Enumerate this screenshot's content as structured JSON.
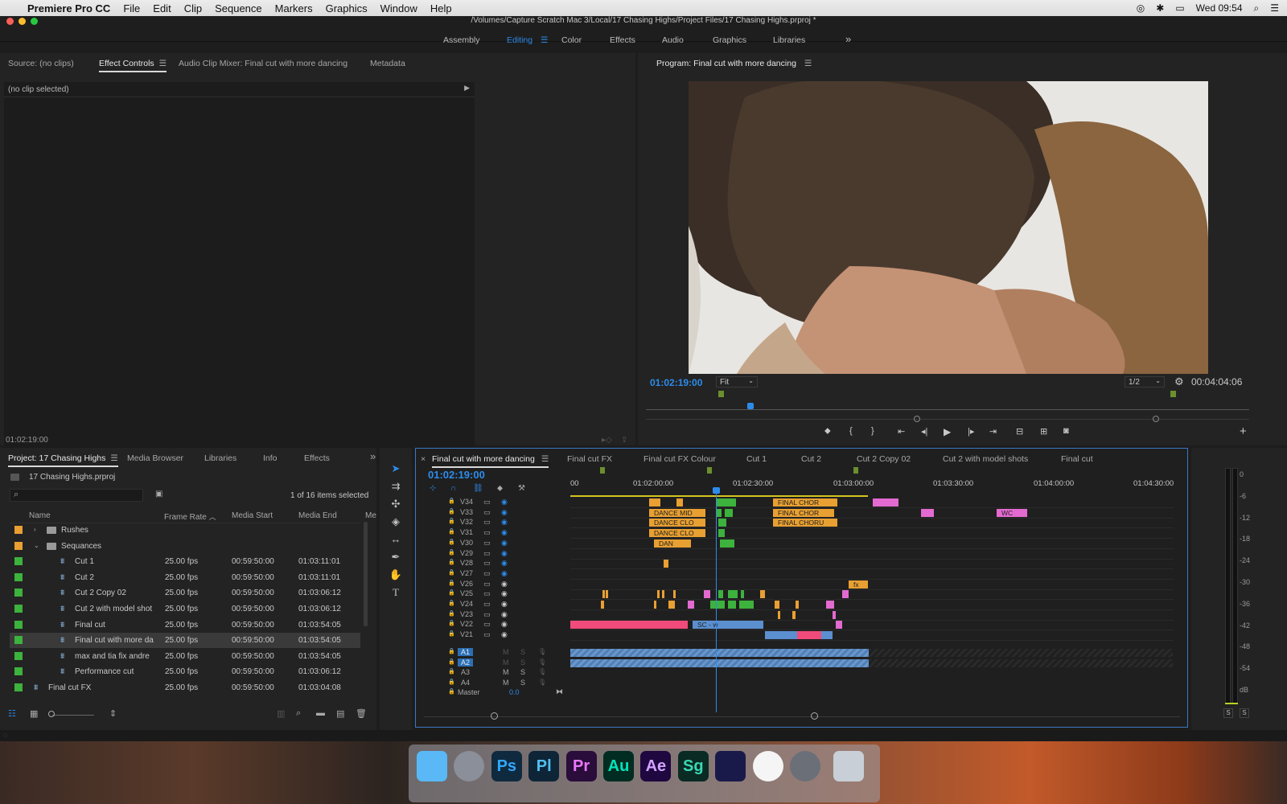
{
  "menubar": {
    "app_name": "Premiere Pro CC",
    "items": [
      "File",
      "Edit",
      "Clip",
      "Sequence",
      "Markers",
      "Graphics",
      "Window",
      "Help"
    ],
    "clock": "Wed 09:54"
  },
  "window": {
    "title": "/Volumes/Capture Scratch Mac 3/Local/17 Chasing Highs/Project Files/17 Chasing Highs.prproj *"
  },
  "workspaces": {
    "tabs": [
      "Assembly",
      "Editing",
      "Color",
      "Effects",
      "Audio",
      "Graphics",
      "Libraries"
    ],
    "active": "Editing",
    "overflow": "»"
  },
  "source_panel": {
    "tabs": [
      "Source: (no clips)",
      "Effect Controls",
      "Audio Clip Mixer: Final cut with more dancing",
      "Metadata"
    ],
    "active_tab": "Effect Controls",
    "no_clip_text": "(no clip selected)",
    "timecode": "01:02:19:00"
  },
  "program_panel": {
    "title": "Program: Final cut with more dancing",
    "timecode": "01:02:19:00",
    "zoom": "Fit",
    "resolution": "1/2",
    "duration": "00:04:04:06"
  },
  "project_panel": {
    "tabs": [
      "Project: 17 Chasing Highs",
      "Media Browser",
      "Libraries",
      "Info",
      "Effects"
    ],
    "active_tab": "Project: 17 Chasing Highs",
    "project_file": "17 Chasing Highs.prproj",
    "selection_status": "1 of 16 items selected",
    "columns": [
      "Name",
      "Frame Rate",
      "Media Start",
      "Media End",
      "Me"
    ],
    "rows": [
      {
        "name": "Rushes",
        "type": "folder",
        "expanded": false,
        "color": "#e8a032",
        "indent": 0,
        "fps": "",
        "start": "",
        "end": ""
      },
      {
        "name": "Sequances",
        "type": "folder",
        "expanded": true,
        "color": "#e8a032",
        "indent": 0,
        "fps": "",
        "start": "",
        "end": ""
      },
      {
        "name": "Cut 1",
        "type": "sequence",
        "color": "#3db23d",
        "indent": 1,
        "fps": "25.00 fps",
        "start": "00:59:50:00",
        "end": "01:03:11:01"
      },
      {
        "name": "Cut 2",
        "type": "sequence",
        "color": "#3db23d",
        "indent": 1,
        "fps": "25.00 fps",
        "start": "00:59:50:00",
        "end": "01:03:11:01"
      },
      {
        "name": "Cut 2 Copy 02",
        "type": "sequence",
        "color": "#3db23d",
        "indent": 1,
        "fps": "25.00 fps",
        "start": "00:59:50:00",
        "end": "01:03:06:12"
      },
      {
        "name": "Cut 2 with model shot",
        "type": "sequence",
        "color": "#3db23d",
        "indent": 1,
        "fps": "25.00 fps",
        "start": "00:59:50:00",
        "end": "01:03:06:12"
      },
      {
        "name": "Final cut",
        "type": "sequence",
        "color": "#3db23d",
        "indent": 1,
        "fps": "25.00 fps",
        "start": "00:59:50:00",
        "end": "01:03:54:05"
      },
      {
        "name": "Final cut with more da",
        "type": "sequence",
        "color": "#3db23d",
        "indent": 1,
        "selected": true,
        "fps": "25.00 fps",
        "start": "00:59:50:00",
        "end": "01:03:54:05"
      },
      {
        "name": "max and tia fix andre",
        "type": "sequence",
        "color": "#3db23d",
        "indent": 1,
        "fps": "25.00 fps",
        "start": "00:59:50:00",
        "end": "01:03:54:05"
      },
      {
        "name": "Performance cut",
        "type": "sequence",
        "color": "#3db23d",
        "indent": 1,
        "fps": "25.00 fps",
        "start": "00:59:50:00",
        "end": "01:03:06:12"
      },
      {
        "name": "Final cut FX",
        "type": "sequence",
        "color": "#3db23d",
        "indent": 0,
        "fps": "25.00 fps",
        "start": "00:59:50:00",
        "end": "01:03:04:08"
      }
    ]
  },
  "timeline": {
    "sequence_tabs": [
      "Final cut with more dancing",
      "Final cut FX",
      "Final cut FX Colour",
      "Cut 1",
      "Cut 2",
      "Cut 2 Copy 02",
      "Cut 2 with model shots",
      "Final cut"
    ],
    "active_tab": "Final cut with more dancing",
    "timecode": "01:02:19:00",
    "ruler_labels": [
      "00",
      "01:02:00:00",
      "01:02:30:00",
      "01:03:00:00",
      "01:03:30:00",
      "01:04:00:00",
      "01:04:30:00"
    ],
    "video_tracks": [
      "V34",
      "V33",
      "V32",
      "V31",
      "V30",
      "V29",
      "V28",
      "V27",
      "V26",
      "V25",
      "V24",
      "V23",
      "V22",
      "V21"
    ],
    "audio_tracks": [
      "A1",
      "A2",
      "A3",
      "A4"
    ],
    "audio_buttons": {
      "mute": "M",
      "solo": "S"
    },
    "master_label": "Master",
    "master_value": "0.0",
    "clip_labels": {
      "dance_1": "DANCE MID",
      "dance_2": "DANCE CLO",
      "dance_3": "DANCE CLO",
      "dance_short": "DAN",
      "final_chor_1": "FINAL CHOR",
      "final_chor_2": "FINAL CHOR",
      "final_chor_3": "FINAL CHORU",
      "wc": "WC",
      "sc": "SC - w",
      "fx": "fx"
    }
  },
  "audio_meter": {
    "scale": [
      "0",
      "-6",
      "-12",
      "-18",
      "-24",
      "-30",
      "-36",
      "-42",
      "-48",
      "-54",
      "dB"
    ],
    "solo_buttons": [
      "S",
      "S"
    ]
  },
  "dock": {
    "apps": [
      {
        "name": "finder",
        "label": ""
      },
      {
        "name": "launchpad",
        "label": ""
      },
      {
        "name": "photoshop",
        "label": "Ps"
      },
      {
        "name": "prelude",
        "label": "Pl"
      },
      {
        "name": "premiere",
        "label": "Pr"
      },
      {
        "name": "audition",
        "label": "Au"
      },
      {
        "name": "after-effects",
        "label": "Ae"
      },
      {
        "name": "speedgrade",
        "label": "Sg"
      },
      {
        "name": "media-encoder",
        "label": ""
      },
      {
        "name": "itunes",
        "label": ""
      },
      {
        "name": "system-preferences",
        "label": ""
      },
      {
        "name": "trash",
        "label": ""
      }
    ]
  },
  "colors": {
    "accent_blue": "#2d8ceb",
    "clip_orange": "#e8a032",
    "clip_green": "#3db23d",
    "clip_pink": "#e36ad0",
    "clip_blue": "#5b8fd0",
    "clip_rose": "#f04b7a"
  }
}
